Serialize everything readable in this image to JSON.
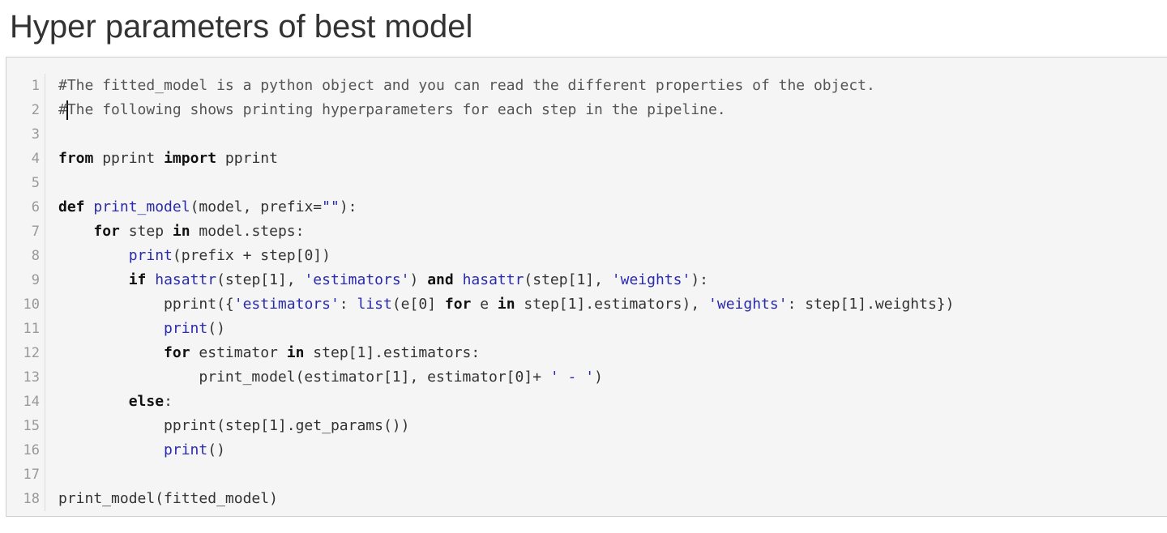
{
  "section": {
    "title": "Hyper parameters of best model"
  },
  "editor": {
    "cursor": {
      "line": 2,
      "after_token": 0
    },
    "lines": [
      {
        "number": "1",
        "tokens": [
          {
            "t": "#The fitted_model is a python object and you can read the different properties of the object.",
            "k": "comment"
          }
        ]
      },
      {
        "number": "2",
        "tokens": [
          {
            "t": "#",
            "k": "comment"
          },
          {
            "t": "The following shows printing hyperparameters for each step in the pipeline.",
            "k": "comment"
          }
        ]
      },
      {
        "number": "3",
        "tokens": []
      },
      {
        "number": "4",
        "tokens": [
          {
            "t": "from",
            "k": "kw"
          },
          {
            "t": " pprint ",
            "k": "plain"
          },
          {
            "t": "import",
            "k": "kw"
          },
          {
            "t": " pprint",
            "k": "plain"
          }
        ]
      },
      {
        "number": "5",
        "tokens": []
      },
      {
        "number": "6",
        "tokens": [
          {
            "t": "def",
            "k": "kw"
          },
          {
            "t": " ",
            "k": "plain"
          },
          {
            "t": "print_model",
            "k": "def"
          },
          {
            "t": "(model, prefix=",
            "k": "plain"
          },
          {
            "t": "\"\"",
            "k": "str"
          },
          {
            "t": "):",
            "k": "plain"
          }
        ]
      },
      {
        "number": "7",
        "tokens": [
          {
            "t": "    ",
            "k": "plain"
          },
          {
            "t": "for",
            "k": "kw"
          },
          {
            "t": " step ",
            "k": "plain"
          },
          {
            "t": "in",
            "k": "kw"
          },
          {
            "t": " model.steps:",
            "k": "plain"
          }
        ]
      },
      {
        "number": "8",
        "tokens": [
          {
            "t": "        ",
            "k": "plain"
          },
          {
            "t": "print",
            "k": "builtin"
          },
          {
            "t": "(prefix + step[0])",
            "k": "plain"
          }
        ]
      },
      {
        "number": "9",
        "tokens": [
          {
            "t": "        ",
            "k": "plain"
          },
          {
            "t": "if",
            "k": "kw"
          },
          {
            "t": " ",
            "k": "plain"
          },
          {
            "t": "hasattr",
            "k": "builtin"
          },
          {
            "t": "(step[1], ",
            "k": "plain"
          },
          {
            "t": "'estimators'",
            "k": "str"
          },
          {
            "t": ") ",
            "k": "plain"
          },
          {
            "t": "and",
            "k": "kw"
          },
          {
            "t": " ",
            "k": "plain"
          },
          {
            "t": "hasattr",
            "k": "builtin"
          },
          {
            "t": "(step[1], ",
            "k": "plain"
          },
          {
            "t": "'weights'",
            "k": "str"
          },
          {
            "t": "):",
            "k": "plain"
          }
        ]
      },
      {
        "number": "10",
        "tokens": [
          {
            "t": "            pprint({",
            "k": "plain"
          },
          {
            "t": "'estimators'",
            "k": "str"
          },
          {
            "t": ": ",
            "k": "plain"
          },
          {
            "t": "list",
            "k": "builtin"
          },
          {
            "t": "(e[0] ",
            "k": "plain"
          },
          {
            "t": "for",
            "k": "kw"
          },
          {
            "t": " e ",
            "k": "plain"
          },
          {
            "t": "in",
            "k": "kw"
          },
          {
            "t": " step[1].estimators), ",
            "k": "plain"
          },
          {
            "t": "'weights'",
            "k": "str"
          },
          {
            "t": ": step[1].weights})",
            "k": "plain"
          }
        ]
      },
      {
        "number": "11",
        "tokens": [
          {
            "t": "            ",
            "k": "plain"
          },
          {
            "t": "print",
            "k": "builtin"
          },
          {
            "t": "()",
            "k": "plain"
          }
        ]
      },
      {
        "number": "12",
        "tokens": [
          {
            "t": "            ",
            "k": "plain"
          },
          {
            "t": "for",
            "k": "kw"
          },
          {
            "t": " estimator ",
            "k": "plain"
          },
          {
            "t": "in",
            "k": "kw"
          },
          {
            "t": " step[1].estimators:",
            "k": "plain"
          }
        ]
      },
      {
        "number": "13",
        "tokens": [
          {
            "t": "                print_model(estimator[1], estimator[0]+ ",
            "k": "plain"
          },
          {
            "t": "' - '",
            "k": "str"
          },
          {
            "t": ")",
            "k": "plain"
          }
        ]
      },
      {
        "number": "14",
        "tokens": [
          {
            "t": "        ",
            "k": "plain"
          },
          {
            "t": "else",
            "k": "kw"
          },
          {
            "t": ":",
            "k": "plain"
          }
        ]
      },
      {
        "number": "15",
        "tokens": [
          {
            "t": "            pprint(step[1].get_params())",
            "k": "plain"
          }
        ]
      },
      {
        "number": "16",
        "tokens": [
          {
            "t": "            ",
            "k": "plain"
          },
          {
            "t": "print",
            "k": "builtin"
          },
          {
            "t": "()",
            "k": "plain"
          }
        ]
      },
      {
        "number": "17",
        "tokens": []
      },
      {
        "number": "18",
        "tokens": [
          {
            "t": "print_model(fitted_model)",
            "k": "plain"
          }
        ]
      }
    ]
  }
}
